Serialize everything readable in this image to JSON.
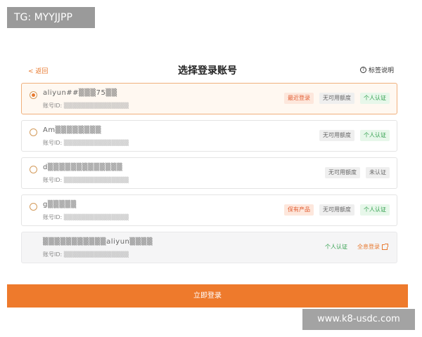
{
  "overlay": {
    "tag": "TG: MYYJJPP",
    "url": "www.k8-usdc.com"
  },
  "header": {
    "back_label": "< 返回",
    "title": "选择登录账号",
    "help_label": "标签说明"
  },
  "accounts": [
    {
      "name": "aliyun##▒▒▒75▒▒",
      "id_label": "账号ID:",
      "id_value": "▒▒▒▒▒▒▒▒▒▒▒▒▒▒▒",
      "selected": true,
      "tags": [
        {
          "text": "最近登录",
          "style": "orange"
        },
        {
          "text": "无可用额度",
          "style": "gray"
        },
        {
          "text": "个人认证",
          "style": "green"
        }
      ]
    },
    {
      "name": "Am▒▒▒▒▒▒▒▒",
      "id_label": "账号ID:",
      "id_value": "▒▒▒▒▒▒▒▒▒▒▒▒▒▒▒",
      "selected": false,
      "tags": [
        {
          "text": "无可用额度",
          "style": "gray"
        },
        {
          "text": "个人认证",
          "style": "green"
        }
      ]
    },
    {
      "name": "d▒▒▒▒▒▒▒▒▒▒▒▒▒",
      "id_label": "账号ID:",
      "id_value": "▒▒▒▒▒▒▒▒▒▒▒▒▒▒▒",
      "selected": false,
      "tags": [
        {
          "text": "无可用额度",
          "style": "gray"
        },
        {
          "text": "未认证",
          "style": "gray"
        }
      ]
    },
    {
      "name": "g▒▒▒▒▒",
      "id_label": "账号ID:",
      "id_value": "▒▒▒▒▒▒▒▒▒▒▒▒▒▒▒",
      "selected": false,
      "tags": [
        {
          "text": "保有产品",
          "style": "orange"
        },
        {
          "text": "无可用额度",
          "style": "gray"
        },
        {
          "text": "个人认证",
          "style": "green"
        }
      ]
    },
    {
      "name": "▒▒▒▒▒▒▒▒▒▒▒aliyun▒▒▒▒",
      "id_label": "账号ID:",
      "id_value": "▒▒▒▒▒▒▒▒▒▒▒▒▒▒▒",
      "selected": false,
      "disabled": true,
      "tags": [
        {
          "text": "个人认证",
          "style": "plain-green"
        },
        {
          "text": "全息登录",
          "style": "link"
        }
      ]
    }
  ],
  "footer": {
    "login_label": "立即登录"
  },
  "colors": {
    "accent": "#ee7a2c",
    "green": "#2e9e4a",
    "orange_tag": "#e25d32"
  }
}
